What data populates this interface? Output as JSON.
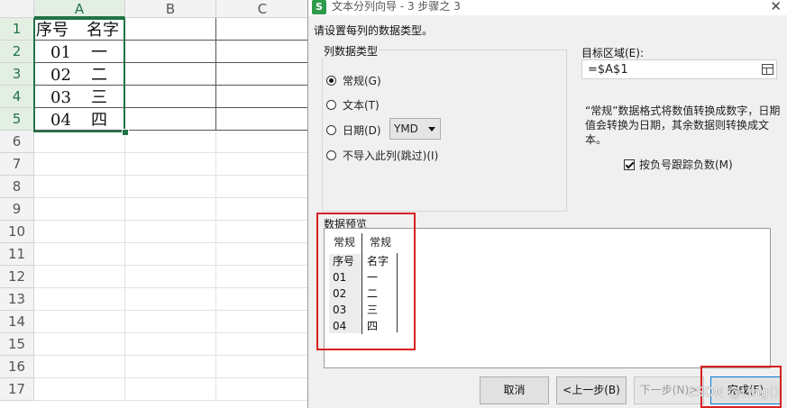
{
  "spreadsheet": {
    "columns": [
      "A",
      "B",
      "C"
    ],
    "rows": [
      "1",
      "2",
      "3",
      "4",
      "5",
      "6",
      "7",
      "8",
      "9",
      "10",
      "11",
      "12",
      "13",
      "14",
      "15",
      "16",
      "17"
    ],
    "cells": [
      {
        "serial": "序号",
        "name": "名字"
      },
      {
        "serial": "01",
        "name": "一"
      },
      {
        "serial": "02",
        "name": "二"
      },
      {
        "serial": "03",
        "name": "三"
      },
      {
        "serial": "04",
        "name": "四"
      }
    ],
    "accent_color": "#217346"
  },
  "dialog": {
    "title": "文本分列向导 - 3 步骤之 3",
    "app_icon_letter": "S",
    "close_glyph": "✕",
    "instruction": "请设置每列的数据类型。",
    "column_type": {
      "group_label": "列数据类型",
      "options": [
        {
          "label": "常规(G)",
          "checked": true
        },
        {
          "label": "文本(T)",
          "checked": false
        },
        {
          "label": "日期(D)",
          "checked": false
        },
        {
          "label": "不导入此列(跳过)(I)",
          "checked": false
        }
      ],
      "date_format": "YMD"
    },
    "target": {
      "label": "目标区域(E):",
      "value": "=$A$1"
    },
    "description": "“常规”数据格式将数值转换成数字，日期值会转换为日期，其余数据则转换成文本。",
    "negative_sign": {
      "label": "按负号跟踪负数(M)",
      "checked": true
    },
    "preview": {
      "label": "数据预览",
      "headers": [
        "常规",
        "常规"
      ],
      "rows": [
        [
          "序号",
          "名字"
        ],
        [
          "01",
          "一"
        ],
        [
          "02",
          "二"
        ],
        [
          "03",
          "三"
        ],
        [
          "04",
          "四"
        ]
      ]
    },
    "buttons": {
      "cancel": "取消",
      "back": "<上一步(B)",
      "next": "下一步(N)>",
      "finish": "完成(F)"
    },
    "highlight_color": "#d92020"
  },
  "watermark": "CSDN @Ling()"
}
